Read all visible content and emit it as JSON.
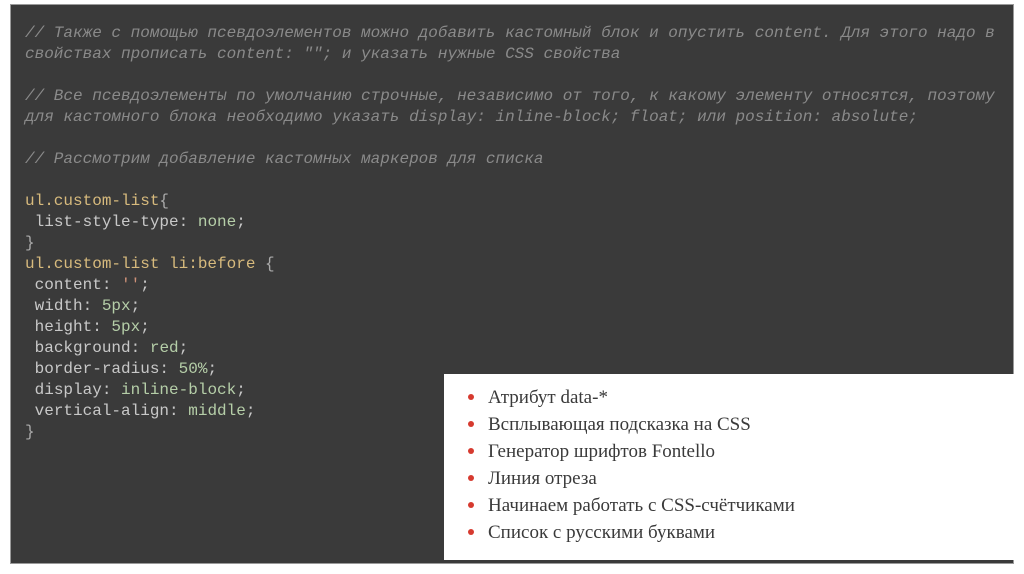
{
  "comment1": "// Также с помощью псевдоэлементов можно добавить кастомный блок и опустить content. Для этого надо в свойствах прописать content: \"\"; и указать нужные CSS свойства",
  "comment2": "// Все псевдоэлементы по умолчанию строчные, независимо от того, к какому элементу относятся, поэтому для кастомного блока необходимо указать display: inline-block; float; или position: absolute;",
  "comment3": "// Рассмотрим добавление кастомных маркеров для списка",
  "code": {
    "line1_a": "ul",
    "line1_b": ".custom-list",
    "line1_c": "{",
    "line2_a": " list-style-type:",
    "line2_b": " none",
    "line2_c": ";",
    "line3": "}",
    "line4_a": "ul",
    "line4_b": ".custom-list",
    "line4_c": " li:before ",
    "line4_d": "{",
    "line5_a": " content:",
    "line5_b": " ''",
    "line5_c": ";",
    "line6_a": " width:",
    "line6_b": " 5px",
    "line6_c": ";",
    "line7_a": " height:",
    "line7_b": " 5px",
    "line7_c": ";",
    "line8_a": " background:",
    "line8_b": " red",
    "line8_c": ";",
    "line9_a": " border-radius:",
    "line9_b": " 50%",
    "line9_c": ";",
    "line10_a": " display:",
    "line10_b": " inline-block",
    "line10_c": ";",
    "line11_a": " vertical-align:",
    "line11_b": " middle",
    "line11_c": ";",
    "line12": "}"
  },
  "list": {
    "items": [
      "Атрибут data-*",
      "Всплывающая подсказка на CSS",
      "Генератор шрифтов Fontello",
      "Линия отреза",
      "Начинаем работать с CSS-счётчиками",
      "Список с русскими буквами"
    ]
  }
}
